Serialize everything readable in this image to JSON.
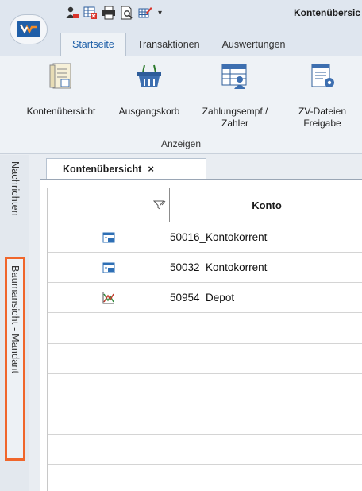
{
  "window": {
    "title": "Kontenübersic"
  },
  "quick_access": {
    "icons": [
      "user-lock-icon",
      "grid-delete-icon",
      "printer-icon",
      "print-preview-icon",
      "grid-edit-icon"
    ],
    "caret": "▾"
  },
  "ribbon_tabs": [
    {
      "label": "Startseite",
      "active": true
    },
    {
      "label": "Transaktionen",
      "active": false
    },
    {
      "label": "Auswertungen",
      "active": false
    }
  ],
  "ribbon": {
    "buttons": [
      {
        "label": "Kontenübersicht",
        "icon": "ledger-icon"
      },
      {
        "label": "Ausgangskorb",
        "icon": "basket-icon"
      },
      {
        "label": "Zahlungsempf./\nZahler",
        "icon": "payee-icon"
      },
      {
        "label": "ZV-Dateien\nFreigabe",
        "icon": "file-settings-icon"
      }
    ],
    "group_label": "Anzeigen"
  },
  "sidebar": {
    "tabs": [
      {
        "label": "Nachrichten",
        "highlighted": false
      },
      {
        "label": "Baumansicht - Mandant",
        "highlighted": true
      }
    ],
    "highlight_color": "#f0662b"
  },
  "document": {
    "tab_label": "Kontenübersicht",
    "close_glyph": "×"
  },
  "grid": {
    "columns": [
      {
        "header": "",
        "icon": "filter-icon"
      },
      {
        "header": "Konto"
      }
    ],
    "rows": [
      {
        "icon": "account-card-icon",
        "konto": "50016_Kontokorrent"
      },
      {
        "icon": "account-card-icon",
        "konto": "50032_Kontokorrent"
      },
      {
        "icon": "depot-chart-icon",
        "konto": "50954_Depot"
      }
    ]
  }
}
